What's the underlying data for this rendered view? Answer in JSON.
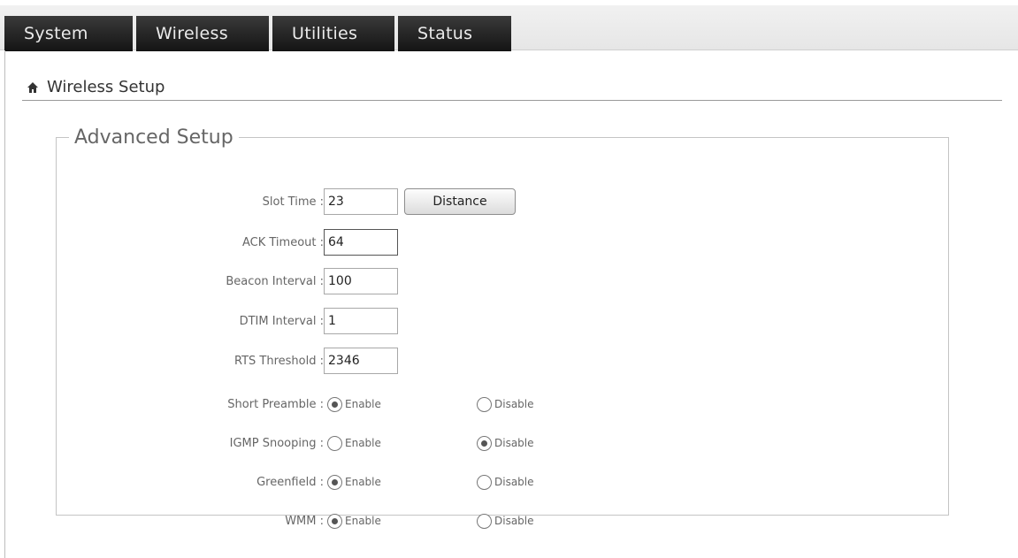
{
  "tabs": [
    {
      "label": "System"
    },
    {
      "label": "Wireless"
    },
    {
      "label": "Utilities"
    },
    {
      "label": "Status"
    }
  ],
  "page": {
    "title": "Wireless Setup",
    "icon": "home-icon"
  },
  "advanced": {
    "legend": "Advanced Setup",
    "slot_time": {
      "label": "Slot Time :",
      "value": "23",
      "button": "Distance"
    },
    "ack_timeout": {
      "label": "ACK Timeout :",
      "value": "64"
    },
    "beacon_interval": {
      "label": "Beacon Interval :",
      "value": "100"
    },
    "dtim_interval": {
      "label": "DTIM Interval :",
      "value": "1"
    },
    "rts_threshold": {
      "label": "RTS Threshold :",
      "value": "2346"
    },
    "radios": [
      {
        "label": "Short Preamble :",
        "enable": "Enable",
        "disable": "Disable",
        "selected": "enable"
      },
      {
        "label": "IGMP Snooping :",
        "enable": "Enable",
        "disable": "Disable",
        "selected": "disable"
      },
      {
        "label": "Greenfield :",
        "enable": "Enable",
        "disable": "Disable",
        "selected": "enable"
      },
      {
        "label": "WMM :",
        "enable": "Enable",
        "disable": "Disable",
        "selected": "enable"
      }
    ]
  },
  "colors": {
    "tab_bg": "#1e1e1e",
    "tab_text": "#eaeaea",
    "border": "#c4c4c4"
  }
}
